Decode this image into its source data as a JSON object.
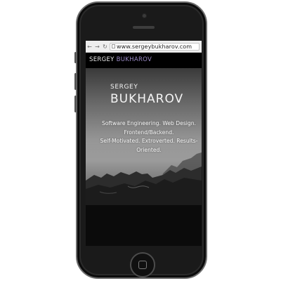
{
  "browser": {
    "back_icon": "←",
    "forward_icon": "→",
    "reload_icon": "↻",
    "url": "www.sergeybukharov.com"
  },
  "site": {
    "logo_first": "SERGEY",
    "logo_last": "BUKHAROV",
    "accent_color": "#9b8bc7"
  },
  "hero": {
    "first_name": "SERGEY",
    "last_name": "BUKHAROV",
    "tagline_lines": [
      "Software Engineering. Web Design.",
      "Frontend/Backend.",
      "Self-Motivated. Extroverted. Results-",
      "Oriented."
    ]
  },
  "device": {
    "icons": [
      "home-button",
      "earpiece",
      "front-camera"
    ]
  }
}
